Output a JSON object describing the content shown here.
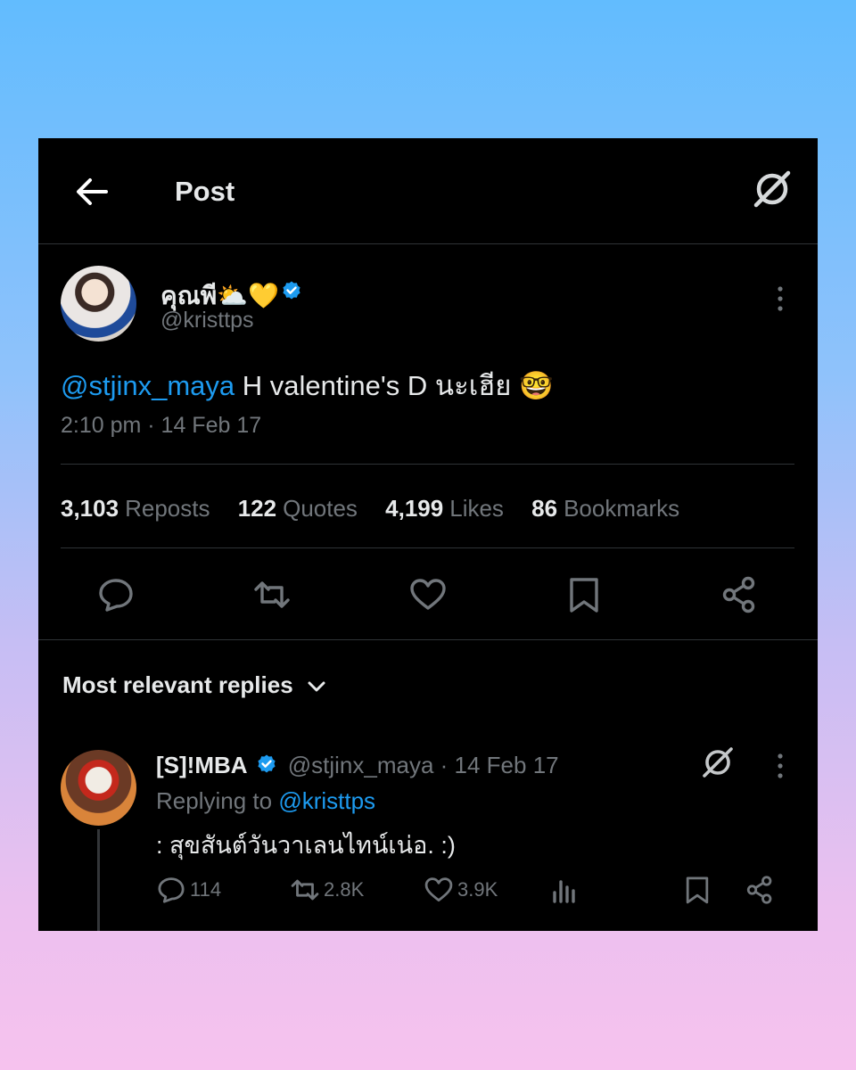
{
  "header": {
    "title": "Post",
    "back_icon": "arrow-left-icon",
    "grok_icon": "grok-icon"
  },
  "tweet": {
    "display_name": "คุณพี⛅💛",
    "handle": "@kristtps",
    "mention": "@stjinx_maya",
    "text": " H valentine's D นะเฮีย 🤓",
    "timestamp": "2:10 pm · 14 Feb 17",
    "stats": {
      "reposts_count": "3,103",
      "reposts_label": "Reposts",
      "quotes_count": "122",
      "quotes_label": "Quotes",
      "likes_count": "4,199",
      "likes_label": "Likes",
      "bookmarks_count": "86",
      "bookmarks_label": "Bookmarks"
    }
  },
  "replies_section": {
    "sort_label": "Most relevant replies"
  },
  "reply": {
    "display_name": "[S]!MBA",
    "handle_and_date": " @stjinx_maya · 14 Feb 17",
    "replying_prefix": "Replying to ",
    "replying_to": "@kristtps",
    "text": ": สุขสันต์วันวาเลนไทน์เน่อ. :)",
    "replies": "114",
    "reposts": "2.8K",
    "likes": "3.9K"
  },
  "colors": {
    "accent": "#1d9bf0",
    "background": "#000000",
    "muted": "#71767b",
    "text": "#e7e9ea"
  }
}
